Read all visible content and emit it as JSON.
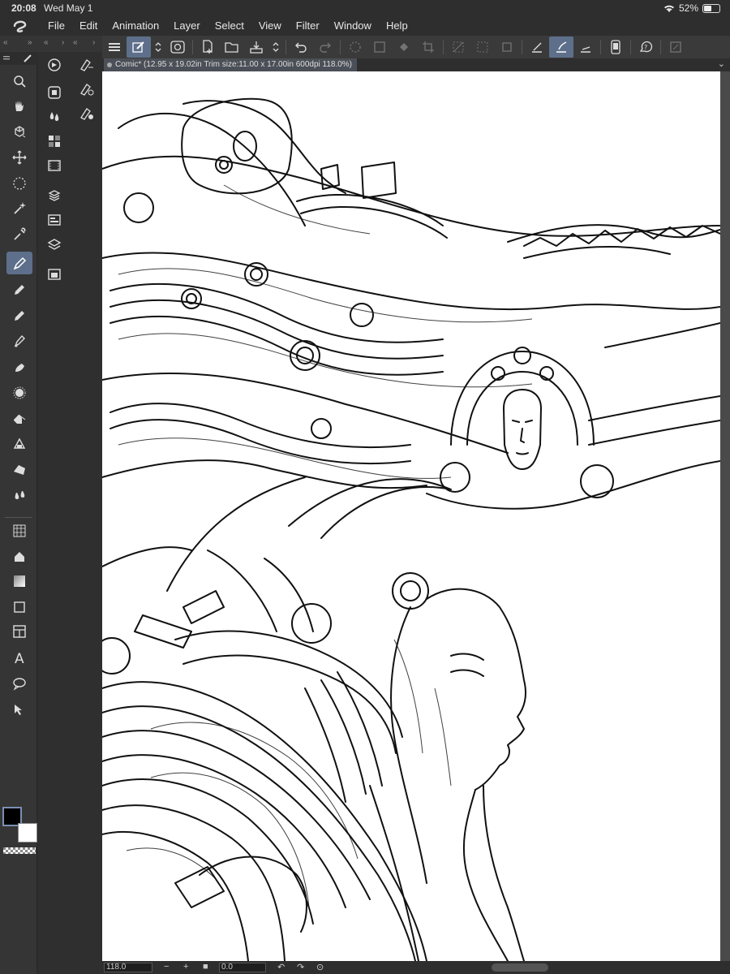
{
  "status": {
    "time": "20:08",
    "date": "Wed May 1",
    "battery": "52%",
    "battery_level": 0.52
  },
  "menu": [
    "File",
    "Edit",
    "Animation",
    "Layer",
    "Select",
    "View",
    "Filter",
    "Window",
    "Help"
  ],
  "document": {
    "tab_title": "Comic* (12.95 x 19.02in Trim size:11.00 x 17.00in 600dpi 118.0%)"
  },
  "bottom": {
    "zoom": "118.0",
    "rotation": "0.0"
  },
  "colors": {
    "accent": "#5d6f8b",
    "main_color": "#000000",
    "sub_color": "#ffffff"
  },
  "tools": [
    "zoom-icon",
    "hand-icon",
    "rotate-icon",
    "move-icon",
    "lasso-select-icon",
    "magic-wand-icon",
    "eyedropper-icon",
    "pen-icon",
    "pencil-icon",
    "brush-icon",
    "airbrush-icon",
    "decoration-icon",
    "blend-icon",
    "eraser-icon",
    "water-icon",
    "ruler-icon",
    "fill-icon",
    "gradient-icon",
    "rectangle-icon",
    "frame-border-icon",
    "ruler-triangle-icon",
    "ellipse-icon",
    "text-icon",
    "balloon-icon",
    "operation-icon"
  ],
  "active_tool": "pen-icon"
}
